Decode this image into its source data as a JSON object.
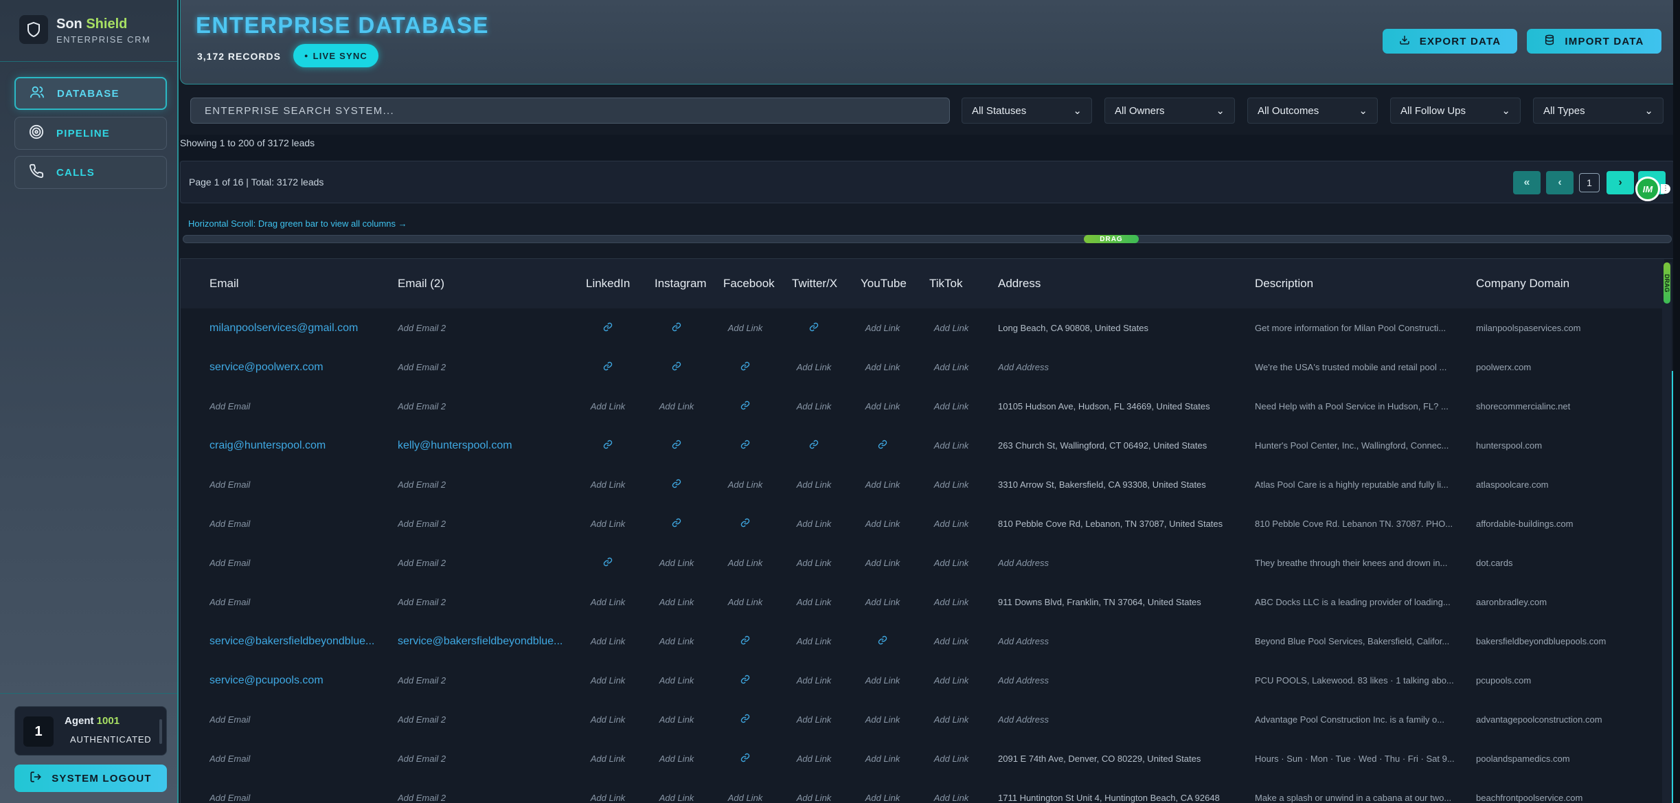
{
  "sidebar": {
    "brand_first": "Son",
    "brand_second": "Shield",
    "brand_sub": "ENTERPRISE CRM",
    "items": [
      {
        "label": "DATABASE",
        "icon": "users-icon",
        "active": true
      },
      {
        "label": "PIPELINE",
        "icon": "target-icon",
        "active": false
      },
      {
        "label": "CALLS",
        "icon": "phone-icon",
        "active": false
      }
    ],
    "agent": {
      "number": "1",
      "name_prefix": "Agent",
      "name_id": "1001",
      "status": "AUTHENTICATED"
    },
    "logout_label": "SYSTEM LOGOUT"
  },
  "header": {
    "title": "ENTERPRISE DATABASE",
    "records": "3,172 RECORDS",
    "live_sync": "LIVE SYNC",
    "export_label": "EXPORT DATA",
    "import_label": "IMPORT DATA"
  },
  "filters": {
    "search_placeholder": "ENTERPRISE SEARCH SYSTEM...",
    "selects": [
      "All Statuses",
      "All Owners",
      "All Outcomes",
      "All Follow Ups",
      "All Types"
    ]
  },
  "info": {
    "showing": "Showing 1 to 200 of 3172 leads",
    "page_text": "Page 1 of 16 | Total: 3172 leads",
    "current_page": "1",
    "first_symbol": "«",
    "prev_symbol": "‹",
    "next_symbol": "›",
    "badge": "IM",
    "hscroll_hint": "Horizontal Scroll: Drag green bar to view all columns →",
    "drag_label": "DRAG"
  },
  "colors": {
    "accent": "#22c6d4",
    "link": "#3fa9e3",
    "brand_green": "#a8e063"
  },
  "table": {
    "columns": [
      "Email",
      "Email (2)",
      "LinkedIn",
      "Instagram",
      "Facebook",
      "Twitter/X",
      "YouTube",
      "TikTok",
      "Address",
      "Description",
      "Company Domain"
    ],
    "placeholders": {
      "email": "Add Email",
      "email2": "Add Email 2",
      "link": "Add Link",
      "address": "Add Address"
    },
    "rows": [
      {
        "email": "milanpoolservices@gmail.com",
        "email2": "",
        "linkedin": true,
        "instagram": true,
        "facebook": false,
        "twitter": true,
        "youtube": false,
        "tiktok": false,
        "address": "Long Beach, CA 90808, United States",
        "description": "Get more information for Milan Pool Constructi...",
        "domain": "milanpoolspaservices.com"
      },
      {
        "email": "service@poolwerx.com",
        "email2": "",
        "linkedin": true,
        "instagram": true,
        "facebook": true,
        "twitter": false,
        "youtube": false,
        "tiktok": false,
        "address": "",
        "description": "We're the USA's trusted mobile and retail pool ...",
        "domain": "poolwerx.com"
      },
      {
        "email": "",
        "email2": "",
        "linkedin": false,
        "instagram": false,
        "facebook": true,
        "twitter": false,
        "youtube": false,
        "tiktok": false,
        "address": "10105 Hudson Ave, Hudson, FL 34669, United States",
        "description": "Need Help with a Pool Service in Hudson, FL? ...",
        "domain": "shorecommercialinc.net"
      },
      {
        "email": "craig@hunterspool.com",
        "email2": "kelly@hunterspool.com",
        "linkedin": true,
        "instagram": true,
        "facebook": true,
        "twitter": true,
        "youtube": true,
        "tiktok": false,
        "address": "263 Church St, Wallingford, CT 06492, United States",
        "description": "Hunter's Pool Center, Inc., Wallingford, Connec...",
        "domain": "hunterspool.com"
      },
      {
        "email": "",
        "email2": "",
        "linkedin": false,
        "instagram": true,
        "facebook": false,
        "twitter": false,
        "youtube": false,
        "tiktok": false,
        "address": "3310 Arrow St, Bakersfield, CA 93308, United States",
        "description": "Atlas Pool Care is a highly reputable and fully li...",
        "domain": "atlaspoolcare.com"
      },
      {
        "email": "",
        "email2": "",
        "linkedin": false,
        "instagram": true,
        "facebook": true,
        "twitter": false,
        "youtube": false,
        "tiktok": false,
        "address": "810 Pebble Cove Rd, Lebanon, TN 37087, United States",
        "description": "810 Pebble Cove Rd. Lebanon TN. 37087. PHO...",
        "domain": "affordable-buildings.com"
      },
      {
        "email": "",
        "email2": "",
        "linkedin": true,
        "instagram": false,
        "facebook": false,
        "twitter": false,
        "youtube": false,
        "tiktok": false,
        "address": "",
        "description": "They breathe through their knees and drown in...",
        "domain": "dot.cards"
      },
      {
        "email": "",
        "email2": "",
        "linkedin": false,
        "instagram": false,
        "facebook": false,
        "twitter": false,
        "youtube": false,
        "tiktok": false,
        "address": "911 Downs Blvd, Franklin, TN 37064, United States",
        "description": "ABC Docks LLC is a leading provider of loading...",
        "domain": "aaronbradley.com"
      },
      {
        "email": "service@bakersfieldbeyondblue...",
        "email2": "service@bakersfieldbeyondblue...",
        "linkedin": false,
        "instagram": false,
        "facebook": true,
        "twitter": false,
        "youtube": true,
        "tiktok": false,
        "address": "",
        "description": "Beyond Blue Pool Services, Bakersfield, Califor...",
        "domain": "bakersfieldbeyondbluepools.com"
      },
      {
        "email": "service@pcupools.com",
        "email2": "",
        "linkedin": false,
        "instagram": false,
        "facebook": true,
        "twitter": false,
        "youtube": false,
        "tiktok": false,
        "address": "",
        "description": "PCU POOLS, Lakewood. 83 likes · 1 talking abo...",
        "domain": "pcupools.com"
      },
      {
        "email": "",
        "email2": "",
        "linkedin": false,
        "instagram": false,
        "facebook": true,
        "twitter": false,
        "youtube": false,
        "tiktok": false,
        "address": "",
        "description": "Advantage Pool Construction Inc. is a family o...",
        "domain": "advantagepoolconstruction.com"
      },
      {
        "email": "",
        "email2": "",
        "linkedin": false,
        "instagram": false,
        "facebook": true,
        "twitter": false,
        "youtube": false,
        "tiktok": false,
        "address": "2091 E 74th Ave, Denver, CO 80229, United States",
        "description": "Hours · Sun · Mon · Tue · Wed · Thu · Fri · Sat 9...",
        "domain": "poolandspamedics.com"
      },
      {
        "email": "",
        "email2": "",
        "linkedin": false,
        "instagram": false,
        "facebook": false,
        "twitter": false,
        "youtube": false,
        "tiktok": false,
        "address": "1711 Huntington St Unit 4, Huntington Beach, CA 92648",
        "description": "Make a splash or unwind in a cabana at our two...",
        "domain": "beachfrontpoolservice.com"
      }
    ]
  }
}
